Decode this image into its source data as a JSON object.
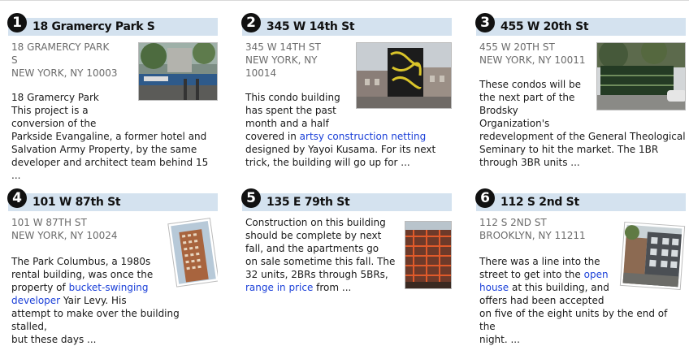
{
  "listings": [
    {
      "number": "1",
      "title": "18 Gramercy Park S",
      "address_line1": "18 GRAMERCY PARK",
      "address_line1b": "S",
      "address_line2": "NEW YORK, NY 10003",
      "desc": [
        {
          "text": "18 Gramercy Park"
        },
        {
          "text": "This project is a"
        },
        {
          "text": "conversion of the"
        },
        {
          "text": "Parkside Evangaline, a former hotel and"
        },
        {
          "text": "Salvation Army Property, by the same"
        },
        {
          "text": "developer and architect team behind 15 ..."
        }
      ]
    },
    {
      "number": "2",
      "title": "345 W 14th St",
      "address_line1": "345 W 14TH ST",
      "address_line2": "NEW YORK, NY",
      "address_line3": "10014",
      "desc": [
        {
          "text": "This condo building"
        },
        {
          "text": "has spent the past"
        },
        {
          "text": "month and a half"
        },
        {
          "pre": "covered in ",
          "link": "artsy construction netting"
        },
        {
          "text": "designed by Yayoi Kusama. For its next"
        },
        {
          "text": "trick, the building will go up for ..."
        }
      ]
    },
    {
      "number": "3",
      "title": "455 W 20th St",
      "address_line1": "455 W 20TH ST",
      "address_line2": "NEW YORK, NY 10011",
      "desc": [
        {
          "text": "These condos will be"
        },
        {
          "text": "the next part of the"
        },
        {
          "text": "Brodsky"
        },
        {
          "text": "Organization's"
        },
        {
          "text": "redevelopment of the General Theological"
        },
        {
          "text": "Seminary to hit the market. The 1BR"
        },
        {
          "text": "through 3BR units ..."
        }
      ]
    },
    {
      "number": "4",
      "title": "101 W 87th St",
      "address_line1": "101 W 87TH ST",
      "address_line2": "NEW YORK, NY 10024",
      "desc": [
        {
          "text": "The Park Columbus, a 1980s"
        },
        {
          "text": "rental building, was once the"
        },
        {
          "pre": "property of ",
          "link": "bucket-swinging"
        },
        {
          "link_first": "developer",
          "post": " Yair Levy. His"
        },
        {
          "text": "attempt to make over the building stalled,"
        },
        {
          "text": "but these days ..."
        }
      ]
    },
    {
      "number": "5",
      "title": "135 E 79th St",
      "desc": [
        {
          "text": "Construction on this building"
        },
        {
          "text": "should be complete by next"
        },
        {
          "text": "fall, and the apartments go"
        },
        {
          "text": "on sale sometime this fall. The"
        },
        {
          "text": "32 units, 2BRs through 5BRs,"
        },
        {
          "link_first": "range in price",
          "post": " from ..."
        }
      ]
    },
    {
      "number": "6",
      "title": "112 S 2nd St",
      "address_line1": "112 S 2ND ST",
      "address_line2": "BROOKLYN, NY 11211",
      "desc": [
        {
          "text": "There was a line into the"
        },
        {
          "pre": "street to get into the ",
          "link": "open"
        },
        {
          "link_first": "house",
          "post": " at this building, and"
        },
        {
          "text": "offers had been accepted"
        },
        {
          "text": "on five of the eight units by the end of the"
        },
        {
          "text": "night. ..."
        }
      ]
    }
  ]
}
